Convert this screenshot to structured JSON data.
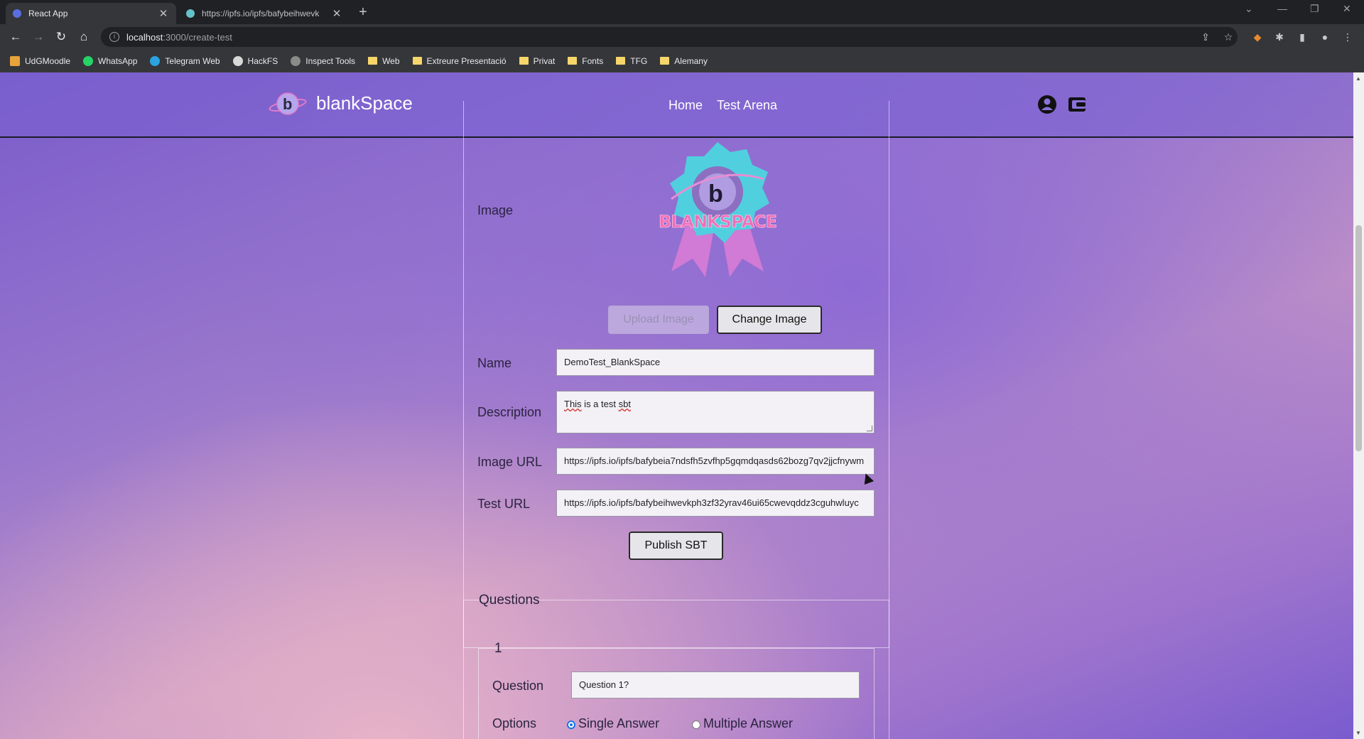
{
  "browser": {
    "tabs": [
      {
        "title": "React App",
        "active": true
      },
      {
        "title": "https://ipfs.io/ipfs/bafybeihwevk",
        "active": false
      }
    ],
    "url_host": "localhost",
    "url_path": ":3000/create-test",
    "bookmarks": [
      "UdGMoodle",
      "WhatsApp",
      "Telegram Web",
      "HackFS",
      "Inspect Tools",
      "Web",
      "Extreure Presentació",
      "Privat",
      "Fonts",
      "TFG",
      "Alemany"
    ]
  },
  "header": {
    "brand": "blankSpace",
    "nav": [
      "Home",
      "Test Arena"
    ]
  },
  "form": {
    "image_label": "Image",
    "badge_text": "BLANKSPACE",
    "upload_label": "Upload Image",
    "change_label": "Change Image",
    "name_label": "Name",
    "name_value": "DemoTest_BlankSpace",
    "description_label": "Description",
    "description_value_word1": "This",
    "description_value_mid": " is a test ",
    "description_value_word2": "sbt",
    "image_url_label": "Image URL",
    "image_url_value": "https://ipfs.io/ipfs/bafybeia7ndsfh5zvfhp5gqmdqasds62bozg7qv2jjcfnywm",
    "test_url_label": "Test URL",
    "test_url_value": "https://ipfs.io/ipfs/bafybeihwevkph3zf32yrav46ui65cwevqddz3cguhwluyc",
    "publish_label": "Publish SBT"
  },
  "questions": {
    "legend": "Questions",
    "item_number": "1",
    "question_label": "Question",
    "question_value": "Question 1?",
    "options_label": "Options",
    "single_label": "Single Answer",
    "multiple_label": "Multiple Answer"
  },
  "colors": {
    "header_bg": "#7860d2",
    "accent": "#1a73e8"
  }
}
